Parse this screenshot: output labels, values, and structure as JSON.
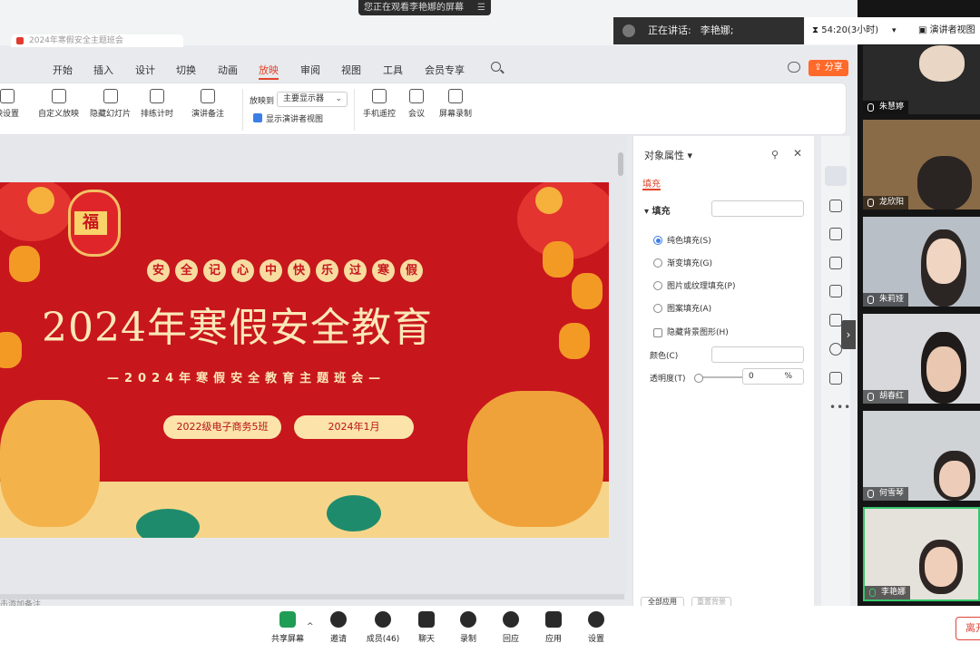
{
  "banner": {
    "text": "您正在观看李艳娜的屏幕"
  },
  "doc_tab": {
    "title": "2024年寒假安全主题班会"
  },
  "speaking": {
    "label": "正在讲话:",
    "name": "李艳娜;"
  },
  "header": {
    "timer": "54:20(3小时)",
    "presenter_view": "演讲者视图"
  },
  "menu": {
    "items": [
      "开始",
      "插入",
      "设计",
      "切换",
      "动画",
      "放映",
      "审阅",
      "视图",
      "工具",
      "会员专享"
    ],
    "active": "放映",
    "share": "分享"
  },
  "ribbon": {
    "left_items": [
      "映设置",
      "自定义放映",
      "隐藏幻灯片",
      "排练计时",
      "演讲备注"
    ],
    "play_to_label": "放映到",
    "monitor": "主要显示器",
    "presenter_checkbox": "显示演讲者视图",
    "right_items": [
      "手机遥控",
      "会议",
      "屏幕录制"
    ]
  },
  "slide": {
    "banner_chars": [
      "安",
      "全",
      "记",
      "心",
      "中",
      "快",
      "乐",
      "过",
      "寒",
      "假"
    ],
    "title": "2024年寒假安全教育",
    "subtitle": "—2024年寒假安全教育主题班会—",
    "class_name": "2022级电子商务5班",
    "date": "2024年1月",
    "lantern_char": "福"
  },
  "status": {
    "text": "击添加备注"
  },
  "props": {
    "title": "对象属性 ▾",
    "tab": "填充",
    "fill_header": "▾ 填充",
    "options": [
      "纯色填充(S)",
      "渐变填充(G)",
      "图片或纹理填充(P)",
      "图案填充(A)"
    ],
    "selected": 0,
    "hide_bg": "隐藏背景图形(H)",
    "color_label": "颜色(C)",
    "transparency_label": "透明度(T)",
    "transparency_value": "0",
    "transparency_unit": "%",
    "apply_all": "全部应用",
    "reset_bg": "重置背景"
  },
  "participants": [
    "朱慧婷",
    "龙欣阳",
    "朱莉娅",
    "胡春红",
    "何雪琴",
    "李艳娜"
  ],
  "toolbar": {
    "items": [
      "共享屏幕",
      "邀请",
      "成员(46)",
      "聊天",
      "录制",
      "回应",
      "应用",
      "设置"
    ],
    "leave": "离开"
  },
  "colors": {
    "accent": "#e0452a",
    "slide_red": "#c8161d",
    "speaking_green": "#35c66b"
  }
}
